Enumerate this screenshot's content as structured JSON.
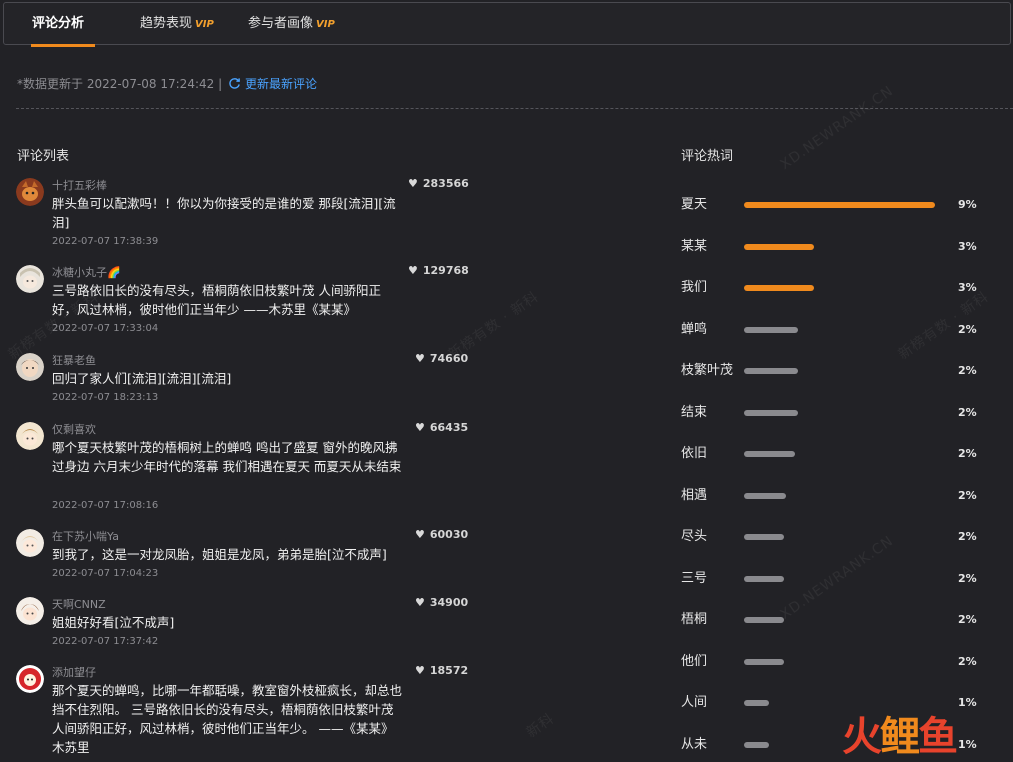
{
  "tabs": [
    {
      "label": "评论分析",
      "vip": ""
    },
    {
      "label": "趋势表现",
      "vip": "VIP"
    },
    {
      "label": "参与者画像",
      "vip": "VIP"
    }
  ],
  "update": {
    "text": "*数据更新于 2022-07-08 17:24:42 |",
    "refresh_label": "更新最新评论"
  },
  "comments_title": "评论列表",
  "keywords_title": "评论热词",
  "comments": [
    {
      "user": "十打五彩棒",
      "likes": "283566",
      "text": "胖头鱼可以配漱吗！！你以为你接受的是谁的爱 那段[流泪][流泪]",
      "time": "2022-07-07 17:38:39"
    },
    {
      "user": "冰糖小丸子🌈",
      "likes": "129768",
      "text": "三号路依旧长的没有尽头，梧桐荫依旧枝繁叶茂 人间骄阳正好，风过林梢，彼时他们正当年少 ——木苏里《某某》",
      "time": "2022-07-07 17:33:04"
    },
    {
      "user": "狂暴老鱼",
      "likes": "74660",
      "text": "回归了家人们[流泪][流泪][流泪]",
      "time": "2022-07-07 18:23:13"
    },
    {
      "user": "仅剩喜欢",
      "likes": "66435",
      "text": "哪个夏天枝繁叶茂的梧桐树上的蝉鸣 鸣出了盛夏 窗外的晚风拂过身边 六月末少年时代的落幕 我们相遇在夏天 而夏天从未结束",
      "time": "2022-07-07 17:08:16"
    },
    {
      "user": "在下苏小喘Ya",
      "likes": "60030",
      "text": "到我了，这是一对龙凤胎，姐姐是龙凤，弟弟是胎[泣不成声]",
      "time": "2022-07-07 17:04:23"
    },
    {
      "user": "天啊CNNZ",
      "likes": "34900",
      "text": "姐姐好好看[泣不成声]",
      "time": "2022-07-07 17:37:42"
    },
    {
      "user": "添加望仔",
      "likes": "18572",
      "text": "那个夏天的蝉鸣，比哪一年都聒噪，教室窗外枝桠疯长，却总也挡不住烈阳。 三号路依旧长的没有尽头，梧桐荫依旧枝繁叶茂人间骄阳正好，风过林梢，彼时他们正当年少。 ——《某某》木苏里",
      "time": ""
    }
  ],
  "colors": {
    "accent": "#f08a1d",
    "bar_gray": "#8a8a8e",
    "link": "#4aa3ff"
  },
  "chart_data": {
    "type": "bar",
    "title": "评论热词",
    "categories": [
      "夏天",
      "某某",
      "我们",
      "蝉鸣",
      "枝繁叶茂",
      "结束",
      "依旧",
      "相遇",
      "尽头",
      "三号",
      "梧桐",
      "他们",
      "人间",
      "从未"
    ],
    "values": [
      9,
      3,
      3,
      2,
      2,
      2,
      2,
      2,
      2,
      2,
      2,
      2,
      1,
      1
    ],
    "bar_values": [
      9,
      3.3,
      3.3,
      2.55,
      2.55,
      2.55,
      2.4,
      2.0,
      1.9,
      1.9,
      1.9,
      1.9,
      1.2,
      1.2
    ],
    "labels": [
      "9%",
      "3%",
      "3%",
      "2%",
      "2%",
      "2%",
      "2%",
      "2%",
      "2%",
      "2%",
      "2%",
      "2%",
      "1%",
      "1%"
    ],
    "highlight_count": 3,
    "xlim": [
      0,
      9
    ]
  },
  "watermarks": [
    "XD.NEWRANK.CN",
    "新榜有数 · 新科",
    "新榜有数 · 新科",
    "新榜有数 · 新科",
    "XD.NEWRANK.CN",
    "新科"
  ],
  "logo": {
    "text1": "火",
    "text2": "鲤",
    "text3": "鱼"
  }
}
